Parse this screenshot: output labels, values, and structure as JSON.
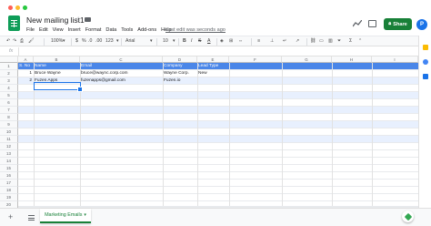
{
  "header": {
    "title": "New mailing list1",
    "last_edit": "Last edit was seconds ago",
    "share_label": "Share",
    "avatar_initial": "P",
    "menu": [
      "File",
      "Edit",
      "View",
      "Insert",
      "Format",
      "Data",
      "Tools",
      "Add-ons",
      "Help"
    ]
  },
  "toolbar": {
    "zoom": "100%",
    "currency": "$",
    "percent": "%",
    "decimals_less": ".0",
    "decimals_more": ".00",
    "number_format": "123",
    "font": "Arial",
    "font_size": "10",
    "bold": "B",
    "italic": "I",
    "strike": "S",
    "text_color": "A"
  },
  "formula_bar": {
    "fx": "fx"
  },
  "grid": {
    "columns": [
      "A",
      "B",
      "C",
      "D",
      "E",
      "F",
      "G",
      "H",
      "I"
    ],
    "rows": [
      "1",
      "2",
      "3",
      "4",
      "5",
      "6",
      "7",
      "8",
      "9",
      "10",
      "11",
      "12",
      "13",
      "14",
      "15",
      "16",
      "17",
      "18",
      "19",
      "20"
    ],
    "header_row": [
      "S. No",
      "Name",
      "Email",
      "Company",
      "Lead Type"
    ],
    "data_rows": [
      [
        "1",
        "Bruce Wayne",
        "bruce@waync.corp.com",
        "Wayne Corp.",
        "New"
      ],
      [
        "2",
        "Fuzen Apps",
        "fuzenapps@gmail.com",
        "Fuzen.io",
        ""
      ]
    ],
    "header_color": "#4a86e8",
    "band_color": "#e8f0fe"
  },
  "sheets": {
    "active_tab": "Marketing Emails",
    "add_icon": "+"
  },
  "colors": {
    "brand_green": "#188038",
    "accent_blue": "#1a73e8"
  }
}
